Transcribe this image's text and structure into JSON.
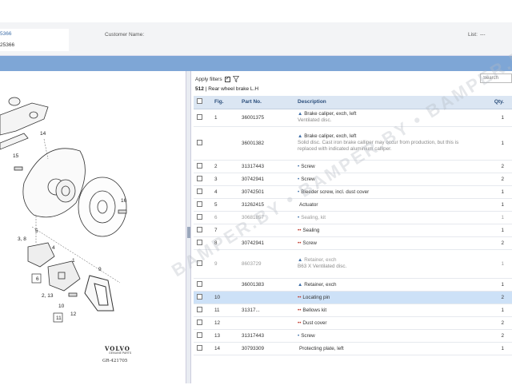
{
  "info": {
    "code_a": "5366",
    "code_b": "25366",
    "customer_label": "Customer Name:",
    "list_label": "List:",
    "list_value": "---"
  },
  "filters": {
    "apply_label": "Apply filters",
    "search_placeholder": "Search"
  },
  "group": {
    "number": "512",
    "separator": "|",
    "title": "Rear wheel brake   L.H"
  },
  "table": {
    "headers": {
      "fig": "Fig.",
      "part_no": "Part No.",
      "description": "Description",
      "qty": "Qty."
    },
    "rows": [
      {
        "fig": "1",
        "part_no": "36001375",
        "bullet": "▲",
        "description": "Brake caliper, exch, left",
        "sub": "Ventilated disc.",
        "qty": "1"
      },
      {
        "fig": "",
        "part_no": "36001382",
        "bullet": "▲",
        "description": "Brake caliper, exch, left",
        "sub": "Solid disc. Cast iron brake calliper may occur from production, but this is replaced with indicated aluminium calliper.",
        "qty": "1"
      },
      {
        "fig": "2",
        "part_no": "31317443",
        "bullet": "•",
        "description": "Screw",
        "sub": "",
        "qty": "2"
      },
      {
        "fig": "3",
        "part_no": "30742941",
        "bullet": "•",
        "description": "Screw",
        "sub": "",
        "qty": "2"
      },
      {
        "fig": "4",
        "part_no": "30742501",
        "bullet": "•",
        "description": "Bleeder screw, incl. dust cover",
        "sub": "",
        "qty": "1"
      },
      {
        "fig": "5",
        "part_no": "31262415",
        "bullet": "",
        "description": "Actuator",
        "sub": "",
        "qty": "1"
      },
      {
        "fig": "6",
        "part_no": "30681857",
        "bullet": "•",
        "description": "Sealing, kit",
        "sub": "",
        "qty": "1"
      },
      {
        "fig": "7",
        "part_no": "",
        "bullet": "••",
        "description": "Sealing",
        "sub": "",
        "qty": "1"
      },
      {
        "fig": "8",
        "part_no": "30742941",
        "bullet": "••",
        "description": "Screw",
        "sub": "",
        "qty": "2"
      },
      {
        "fig": "9",
        "part_no": "8603729",
        "bullet": "▲",
        "description": "Retainer, exch",
        "sub": "B63 X Ventilated disc.",
        "qty": "1"
      },
      {
        "fig": "",
        "part_no": "36001383",
        "bullet": "▲",
        "description": "Retainer, exch",
        "sub": "",
        "qty": "1"
      },
      {
        "fig": "10",
        "part_no": "",
        "bullet": "••",
        "description": "Locating pin",
        "sub": "",
        "qty": "2"
      },
      {
        "fig": "11",
        "part_no": "31317...",
        "bullet": "••",
        "description": "Bellows kit",
        "sub": "",
        "qty": "1"
      },
      {
        "fig": "12",
        "part_no": "",
        "bullet": "••",
        "description": "Dust cover",
        "sub": "",
        "qty": "2"
      },
      {
        "fig": "13",
        "part_no": "31317443",
        "bullet": "•",
        "description": "Screw",
        "sub": "",
        "qty": "2"
      },
      {
        "fig": "14",
        "part_no": "30793309",
        "bullet": "",
        "description": "Protecting plate, left",
        "sub": "",
        "qty": "1"
      }
    ]
  },
  "diagram": {
    "labels": [
      "14",
      "15",
      "16",
      "5",
      "3, 8",
      "4",
      "1",
      "9",
      "6",
      "2, 13",
      "10",
      "12",
      "11"
    ],
    "brand": "VOLVO",
    "brand_sub": "GENUINE PARTS",
    "code": "GR-421705"
  },
  "watermark": "BAMPER.BY • BAMPER.BY • BAMPER.BY",
  "colors": {
    "header_bar": "#7ea6d6",
    "table_header": "#dbe6f3",
    "selected_row": "#cde1f7",
    "link_blue": "#3d6ea8"
  }
}
